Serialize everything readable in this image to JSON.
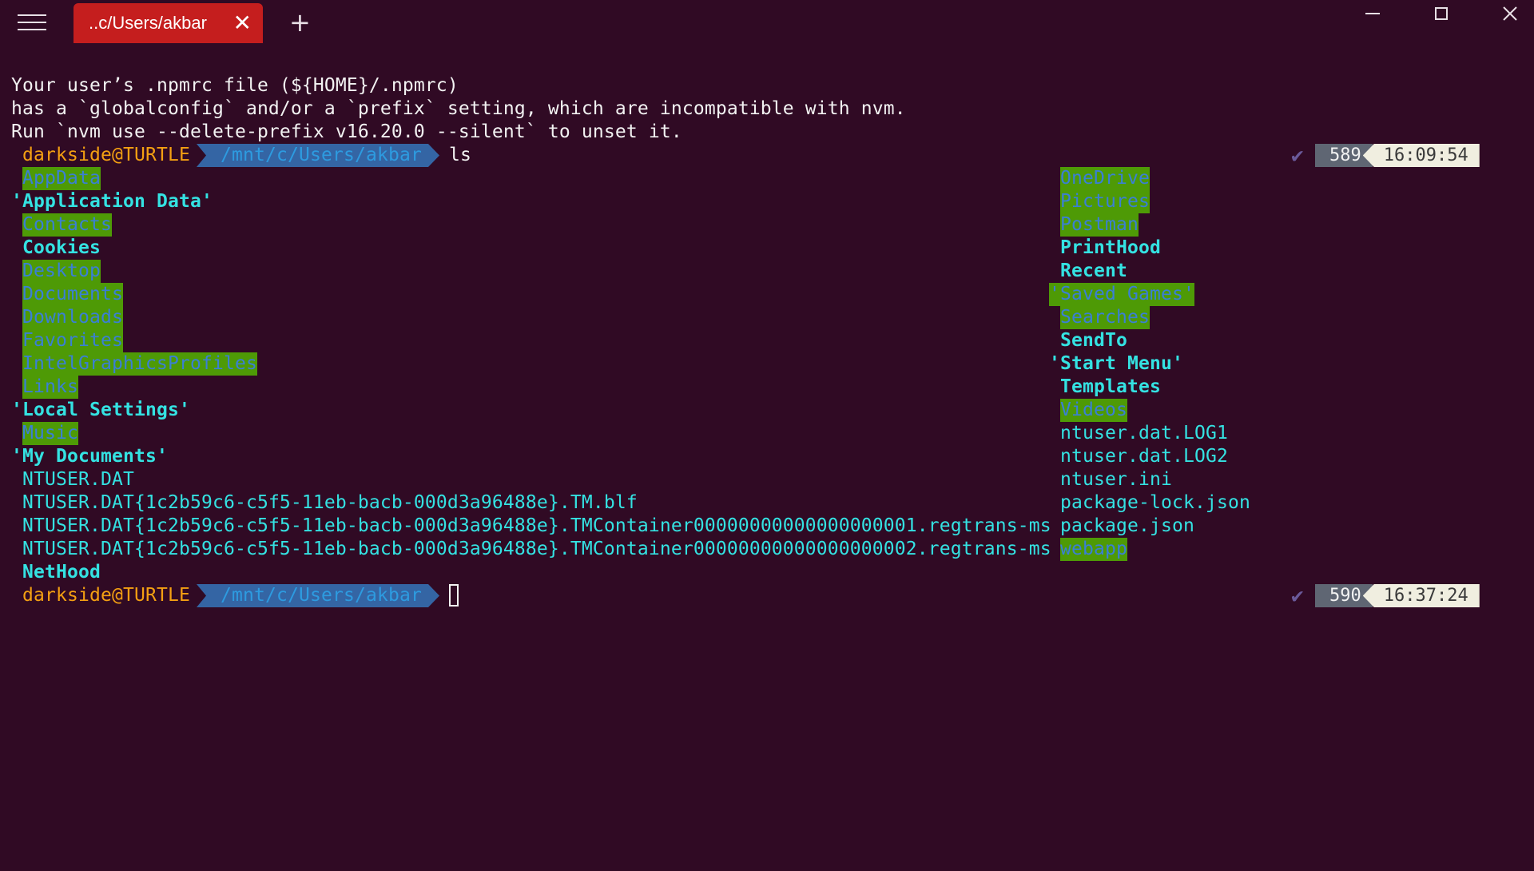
{
  "window": {
    "tab_title": "..c/Users/akbar",
    "tab_close_icon": "✕",
    "new_tab_icon": "+",
    "controls": [
      "minimize",
      "maximize",
      "close"
    ]
  },
  "terminal": {
    "warning_lines": [
      "Your user’s .npmrc file (${HOME}/.npmrc)",
      "has a `globalconfig` and/or a `prefix` setting, which are incompatible with nvm.",
      "Run `nvm use --delete-prefix v16.20.0 --silent` to unset it."
    ],
    "prompts": [
      {
        "user": "darkside@TURTLE",
        "path": "/mnt/c/Users/akbar",
        "command": "ls",
        "status_icon": "✔",
        "cmd_number": "589",
        "time": "16:09:54"
      },
      {
        "user": "darkside@TURTLE",
        "path": "/mnt/c/Users/akbar",
        "command": "",
        "status_icon": "✔",
        "cmd_number": "590",
        "time": "16:37:24"
      }
    ],
    "ls_left": [
      "AppData",
      "'Application Data'",
      "Contacts",
      "Cookies",
      "Desktop",
      "Documents",
      "Downloads",
      "Favorites",
      "IntelGraphicsProfiles",
      "Links",
      "'Local Settings'",
      "Music",
      "'My Documents'",
      "NTUSER.DAT",
      "NTUSER.DAT{1c2b59c6-c5f5-11eb-bacb-000d3a96488e}.TM.blf",
      "NTUSER.DAT{1c2b59c6-c5f5-11eb-bacb-000d3a96488e}.TMContainer00000000000000000001.regtrans-ms",
      "NTUSER.DAT{1c2b59c6-c5f5-11eb-bacb-000d3a96488e}.TMContainer00000000000000000002.regtrans-ms",
      "NetHood"
    ],
    "ls_right": [
      "OneDrive",
      "Pictures",
      "Postman",
      "PrintHood",
      "Recent",
      "'Saved Games'",
      "Searches",
      "SendTo",
      "'Start Menu'",
      "Templates",
      "Videos",
      "ntuser.dat.LOG1",
      "ntuser.dat.LOG2",
      "ntuser.ini",
      "package-lock.json",
      "package.json",
      "webapp"
    ]
  },
  "colors": {
    "background": "#300a24",
    "tab": "#c51e1e",
    "highlight_dir": "#4e9a06",
    "dir_text": "#34e2e2",
    "user": "#f4a012",
    "path_bg": "#3465a4"
  }
}
